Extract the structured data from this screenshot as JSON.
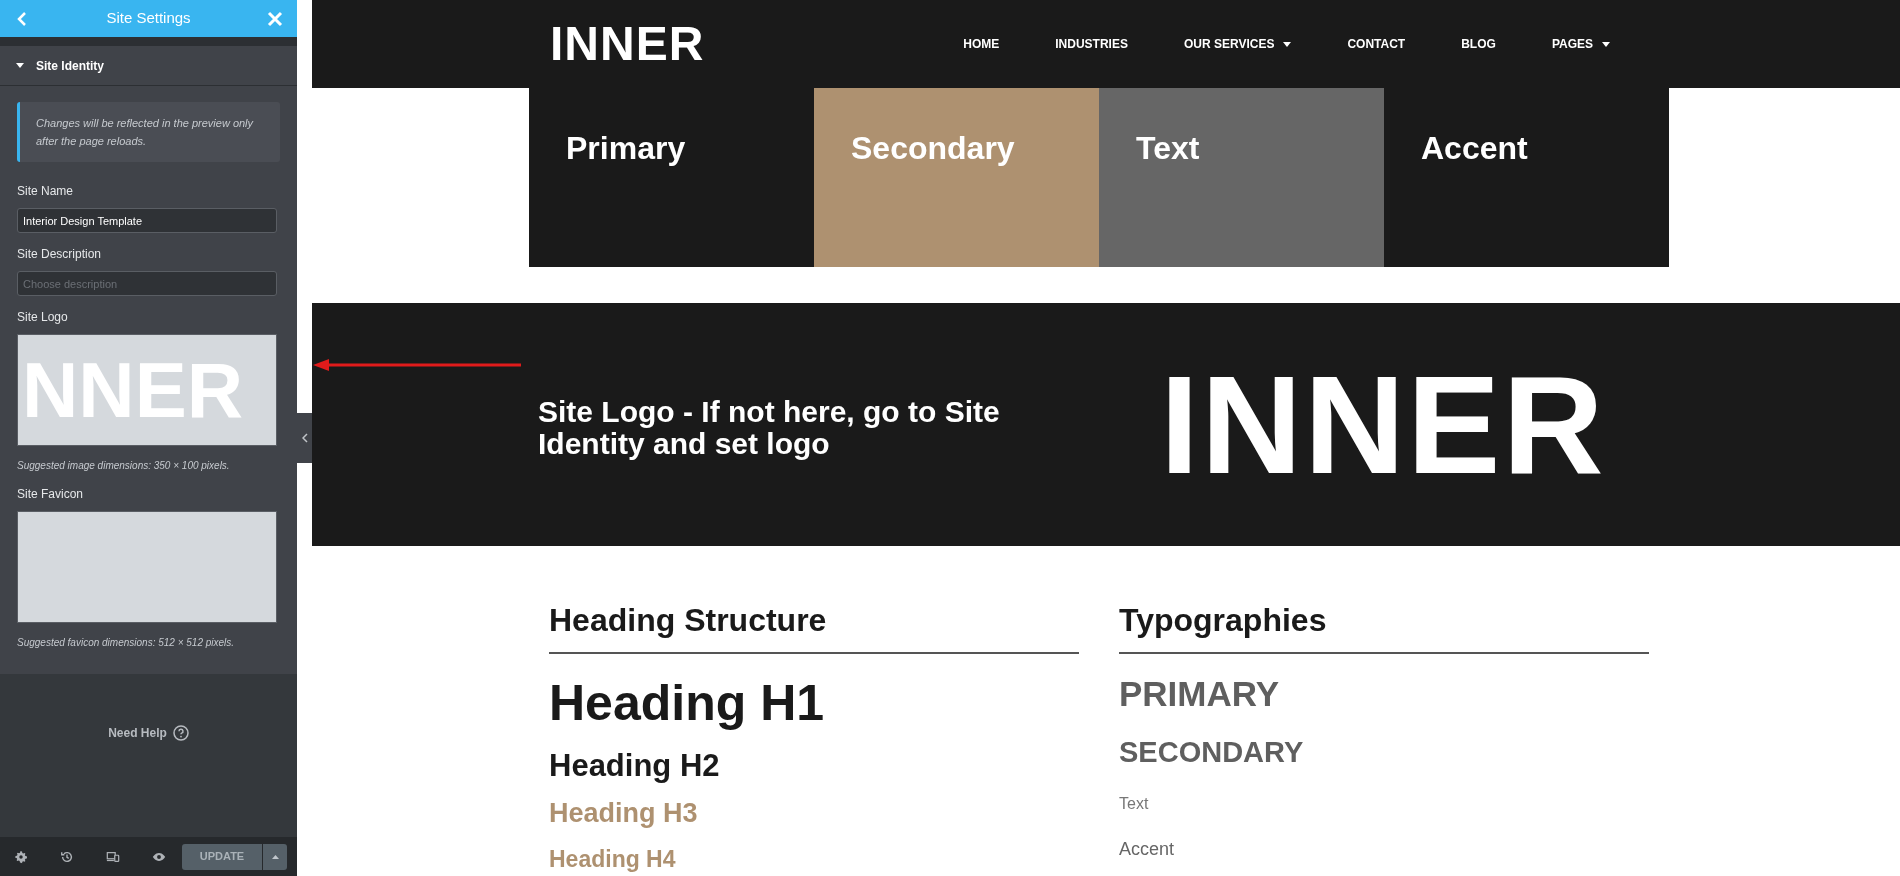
{
  "panel": {
    "title": "Site Settings",
    "section": {
      "title": "Site Identity",
      "expanded": true
    },
    "notice": "Changes will be reflected in the preview only after the page reloads.",
    "controls": [
      {
        "kind": "text",
        "label": "Site Name",
        "value": "Interior Design Template"
      },
      {
        "kind": "text",
        "label": "Site Description",
        "placeholder": "Choose description"
      },
      {
        "kind": "image",
        "label": "Site Logo",
        "preview_text": "NNER",
        "hint": "Suggested image dimensions: 350 × 100 pixels."
      },
      {
        "kind": "image",
        "label": "Site Favicon",
        "hint": "Suggested favicon dimensions: 512 × 512 pixels."
      }
    ],
    "help": "Need Help",
    "footer": {
      "button": "UPDATE"
    }
  },
  "preview": {
    "logo": "INNER",
    "nav": [
      {
        "label": "HOME",
        "dropdown": false
      },
      {
        "label": "INDUSTRIES",
        "dropdown": false
      },
      {
        "label": "OUR SERVICES",
        "dropdown": true
      },
      {
        "label": "CONTACT",
        "dropdown": false
      },
      {
        "label": "BLOG",
        "dropdown": false
      },
      {
        "label": "PAGES",
        "dropdown": true
      }
    ],
    "swatches": [
      {
        "label": "Primary",
        "color": "#1a1a1a"
      },
      {
        "label": "Secondary",
        "color": "#ae9170"
      },
      {
        "label": "Text",
        "color": "#666666"
      },
      {
        "label": "Accent",
        "color": "#1a1a1a"
      }
    ],
    "banner": {
      "text": "Site Logo - If not here, go to Site Identity and set logo",
      "logo": "INNER"
    },
    "heading_structure": {
      "title": "Heading Structure",
      "items": [
        {
          "kind": "h1",
          "text": "Heading H1"
        },
        {
          "kind": "h2",
          "text": "Heading H2"
        },
        {
          "kind": "h3",
          "text": "Heading H3"
        },
        {
          "kind": "h4",
          "text": "Heading H4"
        }
      ]
    },
    "typographies": {
      "title": "Typographies",
      "items": [
        {
          "kind": "primary",
          "text": "PRIMARY"
        },
        {
          "kind": "secondary",
          "text": "SECONDARY"
        },
        {
          "kind": "text",
          "text": "Text"
        },
        {
          "kind": "accent",
          "text": "Accent"
        }
      ]
    }
  }
}
